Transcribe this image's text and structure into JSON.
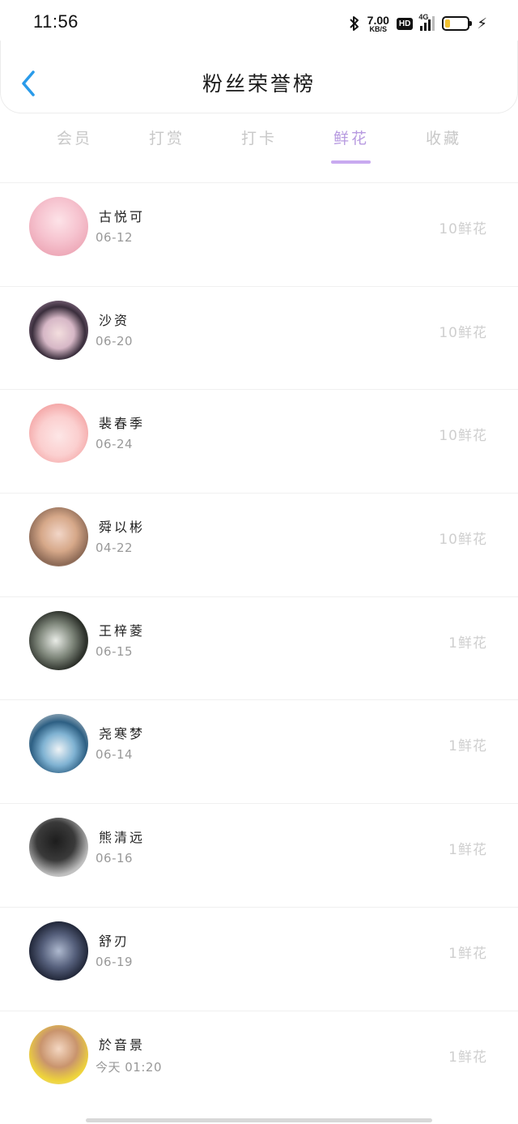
{
  "status_bar": {
    "time": "11:56",
    "net_speed_value": "7.00",
    "net_speed_unit": "KB/S",
    "hd": "HD",
    "network": "4G",
    "battery_level": 0.22,
    "battery_color": "#f2c230"
  },
  "header": {
    "title": "粉丝荣誉榜",
    "back_icon": "chevron-left-icon",
    "accent": "#2a9bea"
  },
  "tabs": [
    {
      "label": "会员",
      "active": false
    },
    {
      "label": "打赏",
      "active": false
    },
    {
      "label": "打卡",
      "active": false
    },
    {
      "label": "鲜花",
      "active": true
    },
    {
      "label": "收藏",
      "active": false
    }
  ],
  "tab_active_color": "#b79ae0",
  "fans": [
    {
      "name": "古悦可",
      "date": "06-12",
      "amount": "10鲜花"
    },
    {
      "name": "沙资",
      "date": "06-20",
      "amount": "10鲜花"
    },
    {
      "name": "裴春季",
      "date": "06-24",
      "amount": "10鲜花"
    },
    {
      "name": "舜以彬",
      "date": "04-22",
      "amount": "10鲜花"
    },
    {
      "name": "王梓菱",
      "date": "06-15",
      "amount": "1鲜花"
    },
    {
      "name": "尧寒梦",
      "date": "06-14",
      "amount": "1鲜花"
    },
    {
      "name": "熊清远",
      "date": "06-16",
      "amount": "1鲜花"
    },
    {
      "name": "舒刃",
      "date": "06-19",
      "amount": "1鲜花"
    },
    {
      "name": "於音景",
      "date": "今天 01:20",
      "amount": "1鲜花"
    }
  ]
}
